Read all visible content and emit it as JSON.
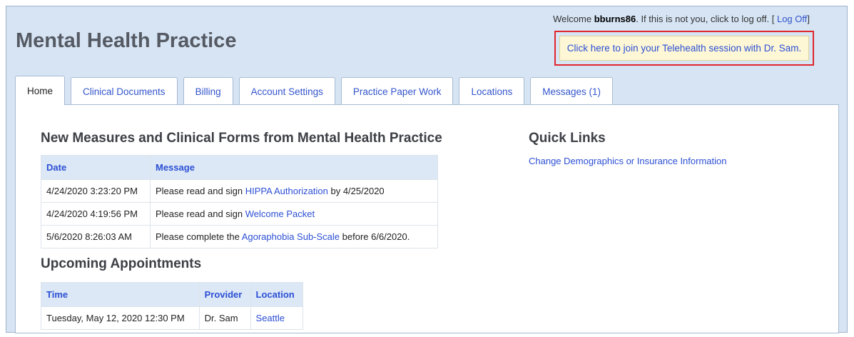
{
  "header": {
    "welcome_prefix": "Welcome",
    "username": "bburns86",
    "welcome_suffix": ". If this is not you, click to log off. [",
    "logoff_label": "Log Off",
    "welcome_close": "]",
    "site_title": "Mental Health Practice",
    "telehealth_label": "Click here to join your Telehealth session with Dr. Sam."
  },
  "tabs": [
    {
      "label": "Home",
      "active": true
    },
    {
      "label": "Clinical Documents"
    },
    {
      "label": "Billing"
    },
    {
      "label": "Account Settings"
    },
    {
      "label": "Practice Paper Work"
    },
    {
      "label": "Locations"
    },
    {
      "label": "Messages (1)"
    }
  ],
  "measures": {
    "heading": "New Measures and Clinical Forms from Mental Health Practice",
    "columns": [
      "Date",
      "Message"
    ],
    "rows": [
      {
        "date": "4/24/2020 3:23:20 PM",
        "pre": "Please read and sign ",
        "link": "HIPPA Authorization",
        "post": " by 4/25/2020"
      },
      {
        "date": "4/24/2020 4:19:56 PM",
        "pre": "Please read and sign ",
        "link": "Welcome Packet",
        "post": ""
      },
      {
        "date": "5/6/2020 8:26:03 AM",
        "pre": "Please complete the ",
        "link": "Agoraphobia Sub-Scale",
        "post": " before 6/6/2020."
      }
    ]
  },
  "appointments": {
    "heading": "Upcoming Appointments",
    "columns": [
      "Time",
      "Provider",
      "Location"
    ],
    "rows": [
      {
        "time": "Tuesday, May 12, 2020 12:30 PM",
        "provider": "Dr. Sam",
        "location": "Seattle"
      }
    ]
  },
  "quick_links": {
    "heading": "Quick Links",
    "items": [
      "Change Demographics or Insurance Information"
    ]
  },
  "colors": {
    "accent_link": "#2c4fd4",
    "highlight_border": "#e0262d",
    "banner_bg": "#fdf7d6",
    "portal_bg": "#d6e4f4"
  }
}
